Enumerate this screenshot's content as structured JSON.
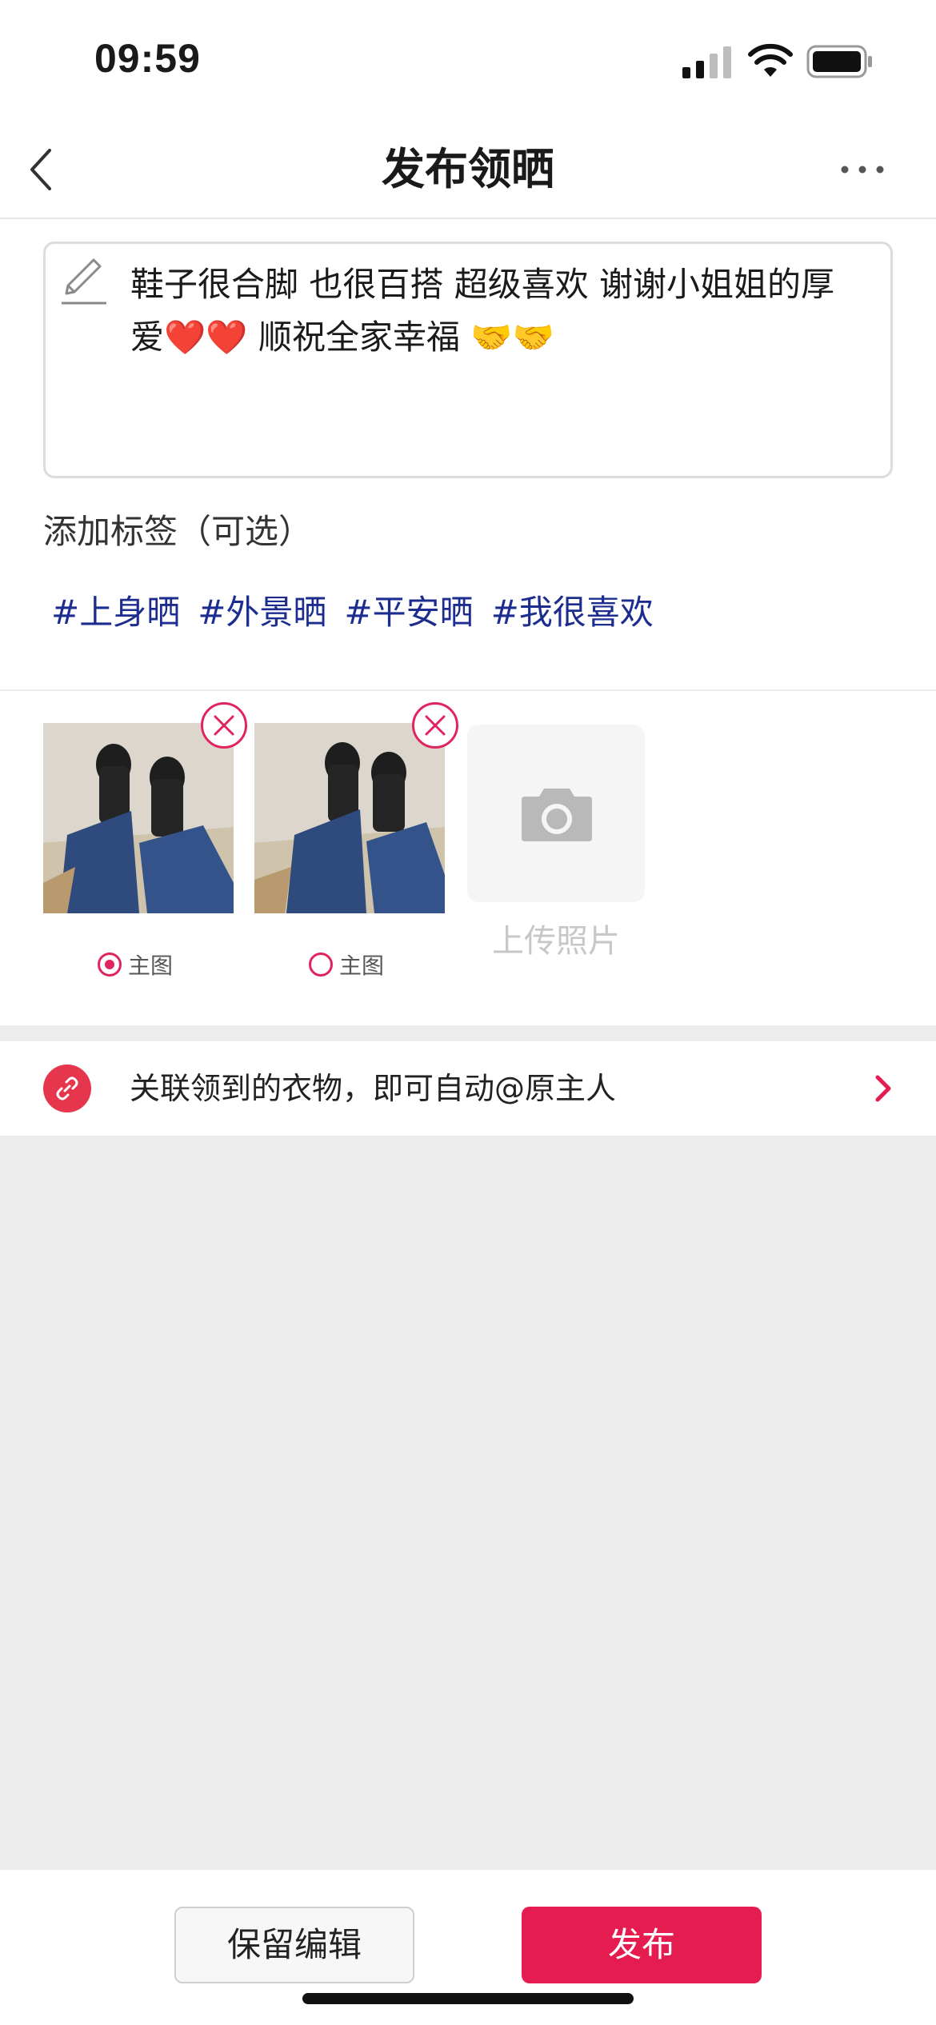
{
  "status_bar": {
    "time": "09:59"
  },
  "nav": {
    "title": "发布领晒"
  },
  "post": {
    "text": "鞋子很合脚 也很百搭 超级喜欢 谢谢小姐姐的厚爱❤️❤️ 顺祝全家幸福 🤝🤝"
  },
  "tags": {
    "label": "添加标签（可选）",
    "items": [
      "#上身晒",
      "#外景晒",
      "#平安晒",
      "#我很喜欢"
    ]
  },
  "photos": {
    "items": [
      {
        "main_label": "主图",
        "is_main": true
      },
      {
        "main_label": "主图",
        "is_main": false
      }
    ],
    "upload_label": "上传照片"
  },
  "link_row": {
    "text": "关联领到的衣物，即可自动@原主人"
  },
  "actions": {
    "save_label": "保留编辑",
    "publish_label": "发布"
  },
  "colors": {
    "accent": "#e51c4f",
    "tag": "#1d2d8f",
    "link_icon_bg": "#e5364d"
  }
}
